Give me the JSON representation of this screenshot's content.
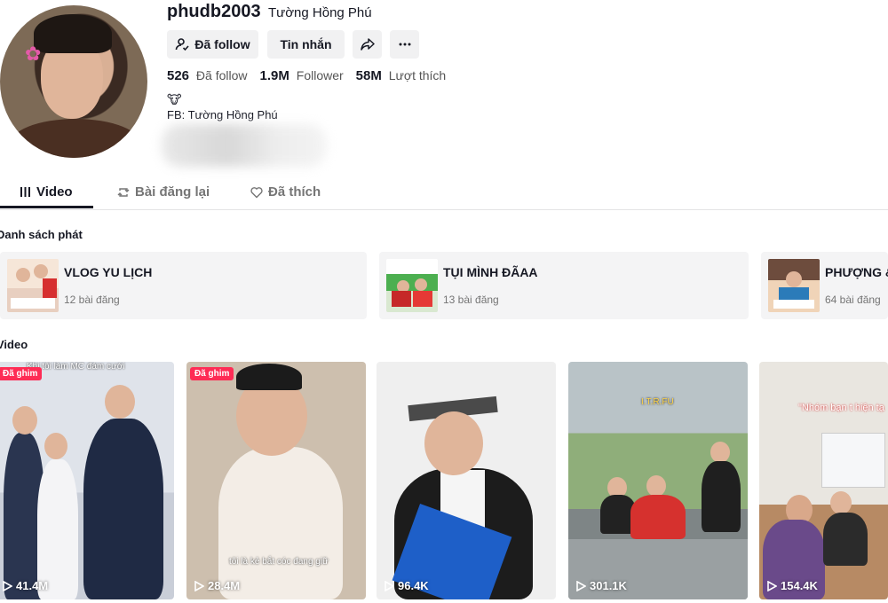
{
  "profile": {
    "username": "phudb2003",
    "nickname": "Tường Hồng Phú",
    "buttons": {
      "follow": "Đã follow",
      "message": "Tin nhắn"
    },
    "stats": {
      "following_count": "526",
      "following_label": "Đã follow",
      "followers_count": "1.9M",
      "followers_label": "Follower",
      "likes_count": "58M",
      "likes_label": "Lượt thích"
    },
    "bio": {
      "emoji": "🐮",
      "line": "FB: Tường Hồng Phú"
    }
  },
  "tabs": [
    {
      "label": "Video",
      "icon": "grid-icon",
      "active": true
    },
    {
      "label": "Bài đăng lại",
      "icon": "repost-icon",
      "active": false
    },
    {
      "label": "Đã thích",
      "icon": "heart-outline-icon",
      "active": false
    }
  ],
  "playlists_section": {
    "title": "Danh sách phát",
    "items": [
      {
        "name": "VLOG YU LỊCH",
        "count": "12 bài đăng"
      },
      {
        "name": "TỤI MÌNH ĐÃAA",
        "count": "13 bài đăng"
      },
      {
        "name": "PHƯỢNG &",
        "count": "64 bài đăng"
      }
    ]
  },
  "videos_section": {
    "title": "Video",
    "items": [
      {
        "views": "41.4M",
        "pinned": true,
        "pin_label": "Đã ghim",
        "caption": "Khi tôi làm MC đám cưới"
      },
      {
        "views": "28.4M",
        "pinned": true,
        "pin_label": "Đã ghim",
        "caption": "tôi là kẻ bắt cóc đang giữ"
      },
      {
        "views": "96.4K",
        "pinned": false
      },
      {
        "views": "301.1K",
        "pinned": false,
        "caption": "I.T.R.FU"
      },
      {
        "views": "154.4K",
        "pinned": false,
        "caption": "\"Nhóm bạn t hiện tạ"
      }
    ]
  },
  "colors": {
    "accent": "#fe2c55",
    "button_bg": "#f1f1f2",
    "text_primary": "#161823",
    "text_secondary": "#757575"
  }
}
